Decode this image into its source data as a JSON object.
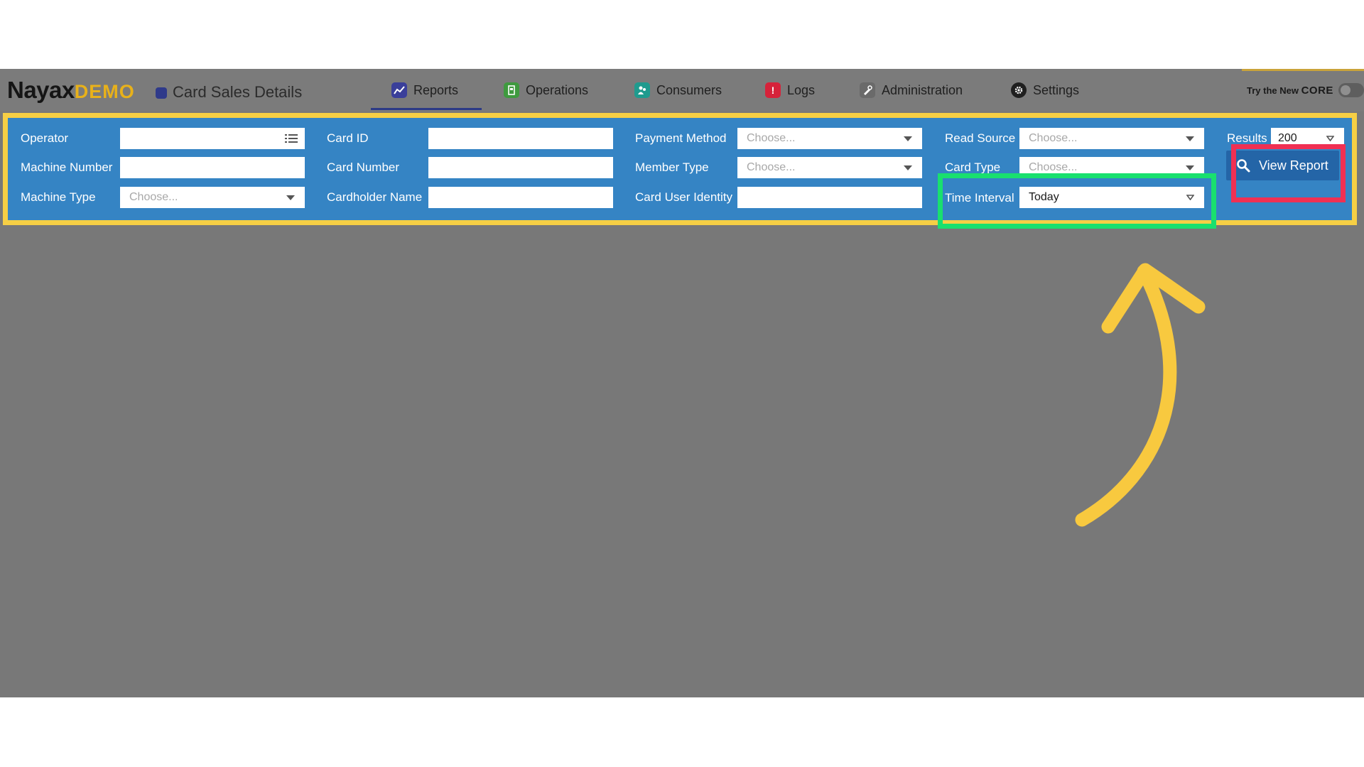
{
  "header": {
    "logo_main": "Nayax",
    "logo_sub": "DEMO",
    "page_title": "Card Sales Details",
    "nav": [
      {
        "label": "Reports",
        "icon": "reports-chart-icon",
        "color": "#3a3f9a"
      },
      {
        "label": "Operations",
        "icon": "operations-icon",
        "color": "#3f9a3f"
      },
      {
        "label": "Consumers",
        "icon": "consumers-icon",
        "color": "#1f9b8e"
      },
      {
        "label": "Logs",
        "icon": "logs-alert-icon",
        "color": "#d6223a"
      },
      {
        "label": "Administration",
        "icon": "administration-icon",
        "color": "#6a6a6a"
      },
      {
        "label": "Settings",
        "icon": "gear-icon",
        "color": "#1f1f1f"
      }
    ],
    "core_prefix": "Try the New",
    "core_word": "CORE"
  },
  "filters": {
    "operator": {
      "label": "Operator",
      "value": ""
    },
    "machine_number": {
      "label": "Machine Number",
      "value": ""
    },
    "machine_type": {
      "label": "Machine Type",
      "placeholder": "Choose..."
    },
    "card_id": {
      "label": "Card ID",
      "value": ""
    },
    "card_number": {
      "label": "Card Number",
      "value": ""
    },
    "cardholder_name": {
      "label": "Cardholder Name",
      "value": ""
    },
    "payment_method": {
      "label": "Payment Method",
      "placeholder": "Choose..."
    },
    "member_type": {
      "label": "Member Type",
      "placeholder": "Choose..."
    },
    "card_user_identity": {
      "label": "Card User Identity",
      "value": ""
    },
    "read_source": {
      "label": "Read Source",
      "placeholder": "Choose..."
    },
    "card_type": {
      "label": "Card Type",
      "placeholder": "Choose..."
    },
    "time_interval": {
      "label": "Time Interval",
      "value": "Today"
    },
    "results": {
      "label": "Results",
      "value": "200"
    }
  },
  "actions": {
    "view_report": "View Report"
  },
  "colors": {
    "panel": "#3584c4",
    "highlight_yellow": "#f6cf45",
    "highlight_green": "#19e06e",
    "highlight_red": "#f03053",
    "arrow": "#f8c93f"
  }
}
